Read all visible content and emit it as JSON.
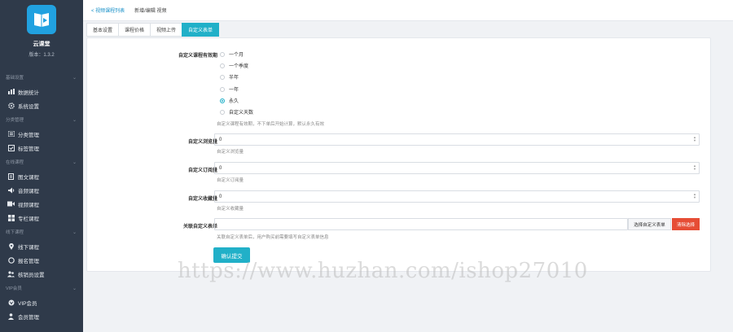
{
  "brand": {
    "name": "云课堂",
    "version": "版本：1.3.2"
  },
  "sidebar": {
    "groups": [
      {
        "label": "基础设置",
        "items": [
          {
            "label": "数据统计",
            "icon": "bar-chart-icon"
          },
          {
            "label": "系统设置",
            "icon": "gear-icon"
          }
        ]
      },
      {
        "label": "分类管理",
        "items": [
          {
            "label": "分类管理",
            "icon": "list-icon"
          },
          {
            "label": "标签管理",
            "icon": "tag-icon"
          }
        ]
      },
      {
        "label": "在线课程",
        "items": [
          {
            "label": "图文课程",
            "icon": "document-icon"
          },
          {
            "label": "音频课程",
            "icon": "audio-icon"
          },
          {
            "label": "视频课程",
            "icon": "video-icon"
          },
          {
            "label": "专栏课程",
            "icon": "grid-icon"
          }
        ]
      },
      {
        "label": "线下课程",
        "items": [
          {
            "label": "线下课程",
            "icon": "location-icon"
          },
          {
            "label": "报名管理",
            "icon": "circle-icon"
          },
          {
            "label": "核销员设置",
            "icon": "users-icon"
          }
        ]
      },
      {
        "label": "VIP会员",
        "items": [
          {
            "label": "VIP会员",
            "icon": "vip-icon"
          },
          {
            "label": "会员管理",
            "icon": "user-icon"
          }
        ]
      }
    ]
  },
  "breadcrumb": {
    "back": "< 视频课程列表",
    "current": "新增/编辑 视频"
  },
  "tabs": [
    {
      "label": "基本设置",
      "active": false
    },
    {
      "label": "课程价格",
      "active": false
    },
    {
      "label": "视频上传",
      "active": false
    },
    {
      "label": "自定义表单",
      "active": true
    }
  ],
  "form": {
    "validity": {
      "label": "自定义课程有效期",
      "options": [
        {
          "label": "一个月",
          "checked": false
        },
        {
          "label": "一个季度",
          "checked": false
        },
        {
          "label": "半年",
          "checked": false
        },
        {
          "label": "一年",
          "checked": false
        },
        {
          "label": "永久",
          "checked": true
        },
        {
          "label": "自定义天数",
          "checked": false
        }
      ],
      "hint": "自定义课程有效期，不下单后开始计算，默认永久有效"
    },
    "views": {
      "label": "自定义浏览量",
      "value": "0",
      "hint": "自定义浏览量"
    },
    "subs": {
      "label": "自定义订阅量",
      "value": "0",
      "hint": "自定义订阅量"
    },
    "favs": {
      "label": "自定义收藏量",
      "value": "0",
      "hint": "自定义收藏量"
    },
    "related": {
      "label": "关联自定义表单",
      "value": "",
      "select_label": "选择自定义表单",
      "clear_label": "清除选择",
      "hint": "关联自定义表单后，用户购买前需要填写自定义表单信息"
    },
    "submit_label": "确认提交"
  },
  "watermark": "https://www.huzhan.com/ishop27010",
  "colors": {
    "accent": "#21b0c8",
    "sidebar": "#2f3a4a",
    "danger": "#e64d35",
    "logo": "#21a1e0"
  }
}
